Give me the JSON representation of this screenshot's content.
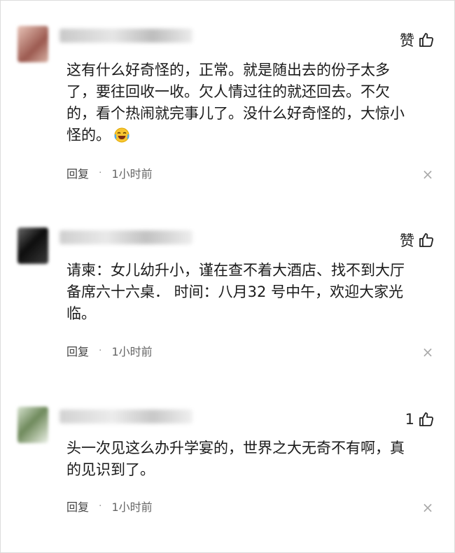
{
  "comments": [
    {
      "like_label": "赞",
      "text_lines": [
        "这有什么好奇怪的，正常。就是随出去的份子太多",
        "了，要往回收一收。欠人情过往的就还回去。不欠",
        "的，看个热闹就完事儿了。没什么好奇怪的，大惊小",
        "怪的。"
      ],
      "emoji": "laughing-crying-emoji",
      "reply_label": "回复",
      "separator": "·",
      "time": "1小时前",
      "avatar_color": "#b07a6e"
    },
    {
      "like_label": "赞",
      "text_lines": [
        "请柬：女儿幼升小，谨在查不着大酒店、找不到大厅",
        "备席六十六桌． 时间：八月32 号中午，欢迎大家光",
        "临。"
      ],
      "reply_label": "回复",
      "separator": "·",
      "time": "1小时前",
      "avatar_color": "#1b1b1b"
    },
    {
      "like_label": "1",
      "text_lines": [
        "头一次见这么办升学宴的，世界之大无奇不有啊，真",
        "的见识到了。"
      ],
      "reply_label": "回复",
      "separator": "·",
      "time": "1小时前",
      "avatar_color": "#7d8f6a"
    }
  ],
  "icons": {
    "like": "thumbs-up-icon",
    "close": "close-icon"
  }
}
